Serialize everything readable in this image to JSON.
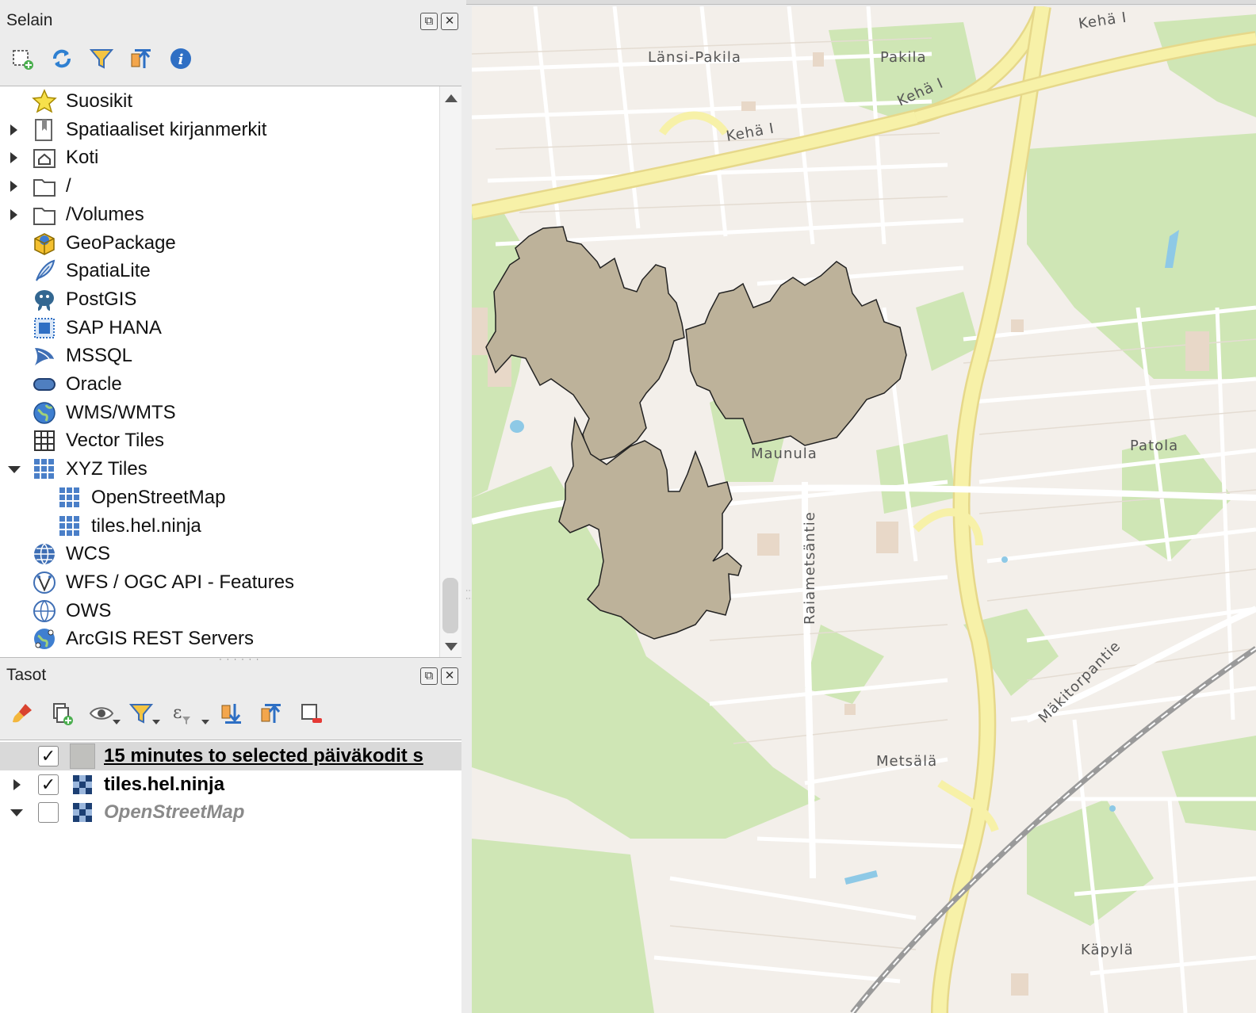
{
  "browser_panel": {
    "title": "Selain",
    "toolbar": [
      "add-selected-layers-icon",
      "refresh-icon",
      "filter-icon",
      "collapse-all-icon",
      "properties-info-icon"
    ],
    "items": [
      {
        "label": "Suosikit",
        "icon": "star-icon",
        "expander": "none"
      },
      {
        "label": "Spatiaaliset kirjanmerkit",
        "icon": "bookmark-icon",
        "expander": "collapsed"
      },
      {
        "label": "Koti",
        "icon": "home-folder-icon",
        "expander": "collapsed"
      },
      {
        "label": "/",
        "icon": "folder-icon",
        "expander": "collapsed"
      },
      {
        "label": "/Volumes",
        "icon": "folder-icon",
        "expander": "collapsed"
      },
      {
        "label": "GeoPackage",
        "icon": "geopackage-icon",
        "expander": "none"
      },
      {
        "label": "SpatiaLite",
        "icon": "spatialite-feather-icon",
        "expander": "none"
      },
      {
        "label": "PostGIS",
        "icon": "postgis-elephant-icon",
        "expander": "none"
      },
      {
        "label": "SAP HANA",
        "icon": "sap-hana-icon",
        "expander": "none"
      },
      {
        "label": "MSSQL",
        "icon": "mssql-icon",
        "expander": "none"
      },
      {
        "label": "Oracle",
        "icon": "oracle-icon",
        "expander": "none"
      },
      {
        "label": "WMS/WMTS",
        "icon": "wms-globe-icon",
        "expander": "none"
      },
      {
        "label": "Vector Tiles",
        "icon": "vector-tiles-icon",
        "expander": "none"
      },
      {
        "label": "XYZ Tiles",
        "icon": "xyz-tiles-icon",
        "expander": "expanded"
      },
      {
        "label": "OpenStreetMap",
        "icon": "xyz-tiles-icon",
        "expander": "child"
      },
      {
        "label": "tiles.hel.ninja",
        "icon": "xyz-tiles-icon",
        "expander": "child"
      },
      {
        "label": "WCS",
        "icon": "wcs-globe-icon",
        "expander": "none"
      },
      {
        "label": "WFS / OGC API - Features",
        "icon": "wfs-icon",
        "expander": "none"
      },
      {
        "label": "OWS",
        "icon": "ows-globe-icon",
        "expander": "none"
      },
      {
        "label": "ArcGIS REST Servers",
        "icon": "arcgis-globe-icon",
        "expander": "none"
      }
    ]
  },
  "layers_panel": {
    "title": "Tasot",
    "toolbar": [
      "style-brush-icon",
      "add-group-icon",
      "visibility-eye-icon",
      "filter-legend-icon",
      "expression-filter-icon",
      "expand-all-icon",
      "collapse-all-icon",
      "remove-layer-icon"
    ],
    "layers": [
      {
        "label": "15 minutes to selected päiväkodit s",
        "checked": true,
        "expander": "none",
        "selected": true,
        "style": "bold-underline",
        "symbol_color": "#c0c0bd"
      },
      {
        "label": "tiles.hel.ninja",
        "checked": true,
        "expander": "collapsed",
        "selected": false,
        "style": "bold"
      },
      {
        "label": "OpenStreetMap",
        "checked": false,
        "expander": "expanded",
        "selected": false,
        "style": "italic-grey"
      }
    ]
  },
  "map": {
    "labels": [
      "Länsi-Pakila",
      "Pakila",
      "Kehä I",
      "Kehä I",
      "Kehä I",
      "Maunula",
      "Patola",
      "Raiametsäntie",
      "Mäkitorpantie",
      "Metsälä",
      "Käpylä"
    ],
    "polygon_fill": "#bdb29a",
    "green_color": "#cfe6b5",
    "road_color": "#f7f1a8",
    "background_color": "#f3efea"
  },
  "dock_buttons": {
    "float": "⧉",
    "close": "✕"
  }
}
